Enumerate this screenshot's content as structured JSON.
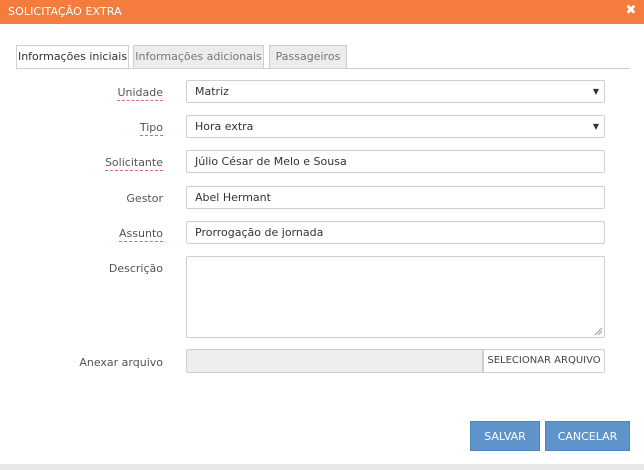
{
  "dialog": {
    "title": "SOLICITAÇÃO EXTRA",
    "close_glyph": "✖"
  },
  "tabs": [
    {
      "label": "Informações iniciais",
      "active": true
    },
    {
      "label": "Informações adicionais",
      "active": false
    },
    {
      "label": "Passageiros",
      "active": false
    }
  ],
  "form": {
    "unidade": {
      "label": "Unidade",
      "value": "Matriz"
    },
    "tipo": {
      "label": "Tipo",
      "value": "Hora extra"
    },
    "solicitante": {
      "label": "Solicitante",
      "value": "Júlio César de Melo e Sousa"
    },
    "gestor": {
      "label": "Gestor",
      "value": "Abel Hermant"
    },
    "assunto": {
      "label": "Assunto",
      "value": "Prorrogação de jornada"
    },
    "descricao": {
      "label": "Descrição",
      "value": ""
    },
    "anexo": {
      "label": "Anexar arquivo",
      "button_label": "SELECIONAR ARQUIVO"
    }
  },
  "actions": {
    "save_label": "SALVAR",
    "cancel_label": "CANCELAR"
  },
  "colors": {
    "titlebar": "#f47c3c",
    "button": "#5e93cc",
    "required_underline": "#e06a6a"
  },
  "icons": {
    "close": "close-icon",
    "dropdown": "chevron-down-icon",
    "resize": "resize-handle-icon"
  }
}
